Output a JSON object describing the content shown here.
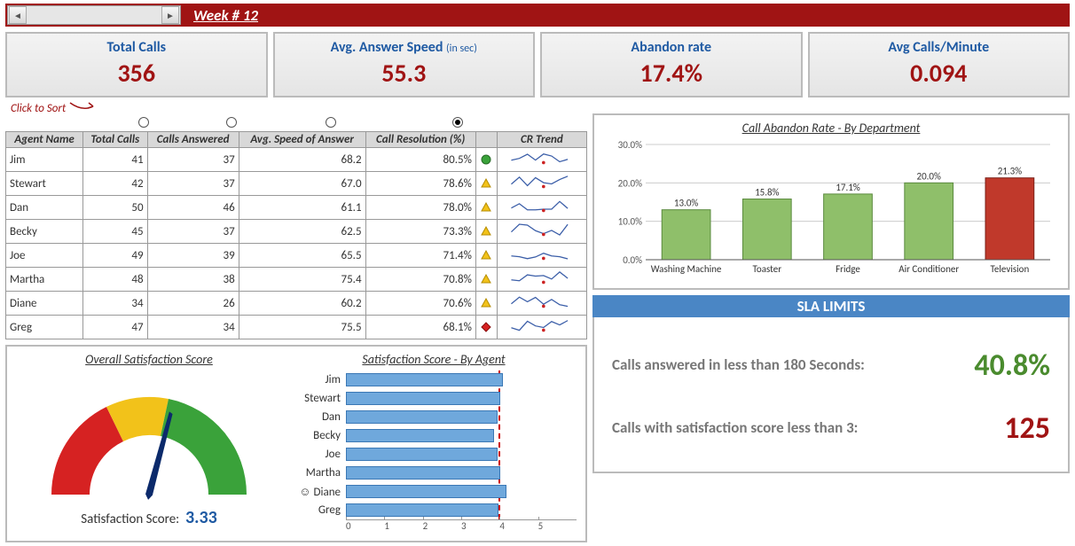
{
  "week": {
    "label": "Week # 12"
  },
  "kpis": {
    "total_calls": {
      "title": "Total Calls",
      "value": "356"
    },
    "avg_answer": {
      "title": "Avg. Answer Speed",
      "sub": "(in sec)",
      "value": "55.3"
    },
    "abandon": {
      "title": "Abandon rate",
      "value": "17.4%"
    },
    "cpm": {
      "title": "Avg Calls/Minute",
      "value": "0.094"
    }
  },
  "sort_hint": "Click to Sort",
  "table": {
    "headers": [
      "Agent Name",
      "Total Calls",
      "Calls Answered",
      "Avg. Speed of Answer",
      "Call Resolution (%)",
      "",
      "CR Trend"
    ],
    "rows": [
      {
        "name": "Jim",
        "total": 41,
        "ans": 37,
        "speed": "68.2",
        "cr": "80.5%",
        "ind": "green"
      },
      {
        "name": "Stewart",
        "total": 42,
        "ans": 37,
        "speed": "67.0",
        "cr": "78.6%",
        "ind": "yellow"
      },
      {
        "name": "Dan",
        "total": 50,
        "ans": 46,
        "speed": "61.1",
        "cr": "78.0%",
        "ind": "yellow"
      },
      {
        "name": "Becky",
        "total": 45,
        "ans": 37,
        "speed": "62.5",
        "cr": "73.3%",
        "ind": "yellow"
      },
      {
        "name": "Joe",
        "total": 49,
        "ans": 39,
        "speed": "65.5",
        "cr": "71.4%",
        "ind": "yellow"
      },
      {
        "name": "Martha",
        "total": 48,
        "ans": 38,
        "speed": "75.4",
        "cr": "70.8%",
        "ind": "yellow"
      },
      {
        "name": "Diane",
        "total": 34,
        "ans": 26,
        "speed": "60.2",
        "cr": "70.6%",
        "ind": "yellow"
      },
      {
        "name": "Greg",
        "total": 47,
        "ans": 34,
        "speed": "75.5",
        "cr": "68.1%",
        "ind": "red"
      }
    ]
  },
  "gauge": {
    "title": "Overall Satisfaction Score",
    "score_label": "Satisfaction Score:",
    "score": "3.33"
  },
  "sat_by_agent": {
    "title": "Satisfaction Score - By Agent",
    "target": 3.3,
    "max": 5,
    "agents": [
      {
        "name": "Jim",
        "v": 3.4,
        "smile": false
      },
      {
        "name": "Stewart",
        "v": 3.35,
        "smile": false
      },
      {
        "name": "Dan",
        "v": 3.28,
        "smile": false
      },
      {
        "name": "Becky",
        "v": 3.22,
        "smile": false
      },
      {
        "name": "Joe",
        "v": 3.28,
        "smile": false
      },
      {
        "name": "Martha",
        "v": 3.35,
        "smile": false
      },
      {
        "name": "Diane",
        "v": 3.48,
        "smile": true
      },
      {
        "name": "Greg",
        "v": 3.3,
        "smile": false
      }
    ]
  },
  "sla": {
    "head": "SLA LIMITS",
    "r1_label": "Calls answered in less than 180 Seconds:",
    "r1_val": "40.8%",
    "r2_label": "Calls with satisfaction score less than 3:",
    "r2_val": "125"
  },
  "chart_data": [
    {
      "type": "bar",
      "title": "Call Abandon Rate - By Department",
      "categories": [
        "Washing Machine",
        "Toaster",
        "Fridge",
        "Air Conditioner",
        "Television"
      ],
      "values": [
        13.0,
        15.8,
        17.1,
        20.0,
        21.3
      ],
      "value_labels": [
        "13.0%",
        "15.8%",
        "17.1%",
        "20.0%",
        "21.3%"
      ],
      "highlight_index": 4,
      "ylim": [
        0,
        30
      ],
      "yticks": [
        "0.0%",
        "10.0%",
        "20.0%",
        "30.0%"
      ],
      "ylabel": "",
      "xlabel": ""
    },
    {
      "type": "bar",
      "orientation": "horizontal",
      "title": "Satisfaction Score - By Agent",
      "categories": [
        "Jim",
        "Stewart",
        "Dan",
        "Becky",
        "Joe",
        "Martha",
        "Diane",
        "Greg"
      ],
      "values": [
        3.4,
        3.35,
        3.28,
        3.22,
        3.28,
        3.35,
        3.48,
        3.3
      ],
      "target_line": 3.3,
      "xlim": [
        0,
        5
      ],
      "xticks": [
        0,
        1,
        2,
        3,
        4,
        5
      ]
    },
    {
      "type": "gauge",
      "title": "Overall Satisfaction Score",
      "value": 3.33,
      "range": [
        0,
        5
      ],
      "zones": [
        {
          "to": 2.0,
          "color": "#d62222"
        },
        {
          "to": 3.0,
          "color": "#f2c21a"
        },
        {
          "to": 5.0,
          "color": "#3aa23a"
        }
      ]
    }
  ]
}
